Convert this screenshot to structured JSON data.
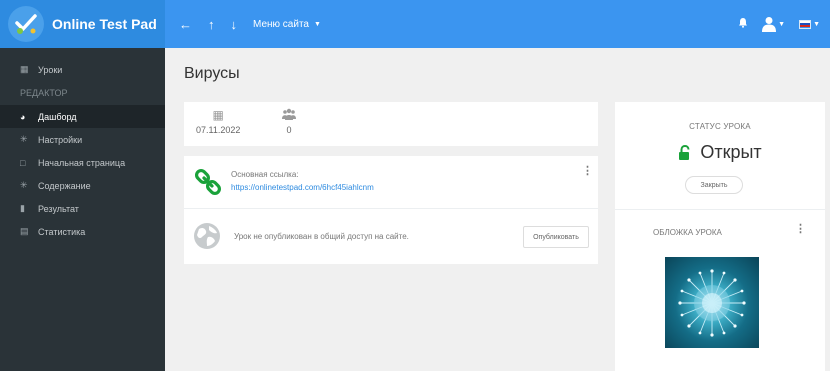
{
  "header": {
    "brand": "Online Test Pad",
    "menu_site": "Меню сайта"
  },
  "sidebar": {
    "lessons": "Уроки",
    "section": "РЕДАКТОР",
    "items": [
      {
        "label": "Дашборд",
        "active": true
      },
      {
        "label": "Настройки"
      },
      {
        "label": "Начальная страница"
      },
      {
        "label": "Содержание"
      },
      {
        "label": "Результат"
      },
      {
        "label": "Статистика"
      }
    ]
  },
  "main": {
    "title": "Вирусы",
    "stats": {
      "date": "07.11.2022",
      "participants": "0"
    },
    "link": {
      "label": "Основная ссылка:",
      "url": "https://onlinetestpad.com/6hcf45iahlcnm"
    },
    "publish": {
      "text": "Урок не опубликован в общий доступ на сайте.",
      "button": "Опубликовать"
    }
  },
  "status": {
    "title": "СТАТУС УРОКА",
    "value": "Открыт",
    "close_button": "Закрыть",
    "accent": "#1aa23a"
  },
  "cover": {
    "title": "ОБЛОЖКА УРОКА"
  },
  "colors": {
    "topbar": "#3b95f0",
    "brand_bg": "#2e8be0",
    "sidebar_bg": "#2a3338",
    "link": "#2e8be0",
    "link_icon": "#1aa23a"
  }
}
